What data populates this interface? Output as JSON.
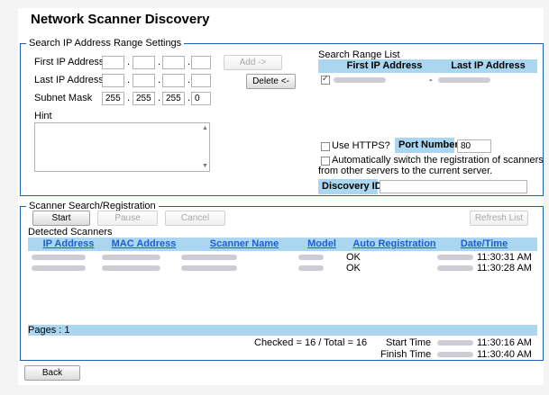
{
  "title": "Network Scanner Discovery",
  "range_settings": {
    "legend": "Search IP Address Range Settings",
    "first_ip_label": "First IP Address",
    "last_ip_label": "Last IP Address",
    "subnet_label": "Subnet Mask",
    "subnet": [
      "255",
      "255",
      "255",
      "0"
    ],
    "hint_label": "Hint",
    "add_button": "Add ->",
    "delete_button": "Delete <-"
  },
  "search_range": {
    "label": "Search Range List",
    "col_first": "First IP Address",
    "col_last": "Last IP Address",
    "separator": "-",
    "row_checked": true
  },
  "options": {
    "use_https_label": "Use HTTPS?",
    "port_label": "Port Number",
    "port_value": "80",
    "auto_switch_line1": "Automatically switch the registration of scanners",
    "auto_switch_line2": "from other servers to the current server.",
    "discovery_id_label": "Discovery ID",
    "discovery_id_value": ""
  },
  "scanner_search": {
    "legend": "Scanner Search/Registration",
    "start_button": "Start",
    "pause_button": "Pause",
    "cancel_button": "Cancel",
    "refresh_button": "Refresh List",
    "detected_label": "Detected Scanners",
    "columns": [
      "IP Address",
      "MAC Address",
      "Scanner Name",
      "Model",
      "Auto Registration",
      "Date/Time"
    ],
    "rows": [
      {
        "auto_registration": "OK",
        "time": "11:30:31 AM"
      },
      {
        "auto_registration": "OK",
        "time": "11:30:28 AM"
      }
    ],
    "pages": "Pages : 1",
    "checked_total": "Checked = 16 / Total = 16",
    "start_time_label": "Start Time",
    "start_time": "11:30:16 AM",
    "finish_time_label": "Finish Time",
    "finish_time": "11:30:40 AM"
  },
  "back_button": "Back",
  "colors": {
    "header_bg": "#aad7ef",
    "border": "#1c5fb5",
    "link": "#1f5bd6"
  }
}
